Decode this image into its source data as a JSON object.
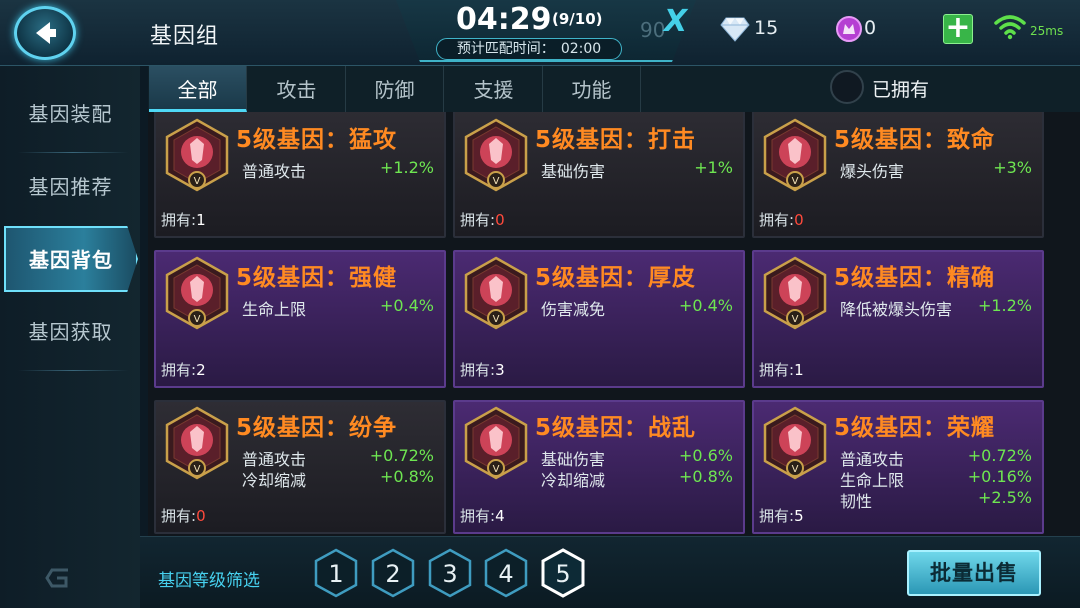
{
  "header": {
    "title": "基因组",
    "timer": "04:29",
    "queue_count": "(9/10)",
    "match_time_label": "预计匹配时间：",
    "match_time_value": "02:00",
    "ghost_number": "90",
    "x_logo": "X",
    "diamond_count": "15",
    "gem_count": "0",
    "ping": "25ms"
  },
  "sidebar": {
    "items": [
      {
        "label": "基因装配"
      },
      {
        "label": "基因推荐"
      },
      {
        "label": "基因背包",
        "active": true
      },
      {
        "label": "基因获取"
      }
    ]
  },
  "tabs": [
    {
      "label": "全部",
      "active": true
    },
    {
      "label": "攻击"
    },
    {
      "label": "防御"
    },
    {
      "label": "支援"
    },
    {
      "label": "功能"
    }
  ],
  "owned_filter_label": "已拥有",
  "owned_prefix": "拥有:",
  "cards": [
    {
      "name": "5级基因：猛攻",
      "rarity": "gray",
      "stats": [
        {
          "k": "普通攻击",
          "v": "+1.2%"
        }
      ],
      "owned": "1"
    },
    {
      "name": "5级基因：打击",
      "rarity": "gray",
      "stats": [
        {
          "k": "基础伤害",
          "v": "+1%"
        }
      ],
      "owned": "0"
    },
    {
      "name": "5级基因：致命",
      "rarity": "gray",
      "stats": [
        {
          "k": "爆头伤害",
          "v": "+3%"
        }
      ],
      "owned": "0"
    },
    {
      "name": "5级基因：强健",
      "rarity": "purple",
      "stats": [
        {
          "k": "生命上限",
          "v": "+0.4%"
        }
      ],
      "owned": "2"
    },
    {
      "name": "5级基因：厚皮",
      "rarity": "purple",
      "stats": [
        {
          "k": "伤害减免",
          "v": "+0.4%"
        }
      ],
      "owned": "3"
    },
    {
      "name": "5级基因：精确",
      "rarity": "purple",
      "stats": [
        {
          "k": "降低被爆头伤害",
          "v": "+1.2%"
        }
      ],
      "owned": "1"
    },
    {
      "name": "5级基因：纷争",
      "rarity": "gray",
      "stats": [
        {
          "k": "普通攻击",
          "v": "+0.72%"
        },
        {
          "k": "冷却缩减",
          "v": "+0.8%"
        }
      ],
      "owned": "0"
    },
    {
      "name": "5级基因：战乱",
      "rarity": "purple",
      "stats": [
        {
          "k": "基础伤害",
          "v": "+0.6%"
        },
        {
          "k": "冷却缩减",
          "v": "+0.8%"
        }
      ],
      "owned": "4"
    },
    {
      "name": "5级基因：荣耀",
      "rarity": "purple",
      "stats": [
        {
          "k": "普通攻击",
          "v": "+0.72%"
        },
        {
          "k": "生命上限",
          "v": "+0.16%"
        },
        {
          "k": "韧性",
          "v": "+2.5%"
        }
      ],
      "owned": "5"
    }
  ],
  "badge_letter": "V",
  "filter": {
    "label": "基因等级筛选",
    "levels": [
      "1",
      "2",
      "3",
      "4",
      "5"
    ],
    "selected": "5"
  },
  "sell_button": "批量出售",
  "colors": {
    "accent": "#4fd8f5",
    "gene_name": "#ff8a22",
    "stat_value": "#6ee651",
    "zero_owned": "#ff4a3c",
    "purple_card": "#4b2a72"
  }
}
